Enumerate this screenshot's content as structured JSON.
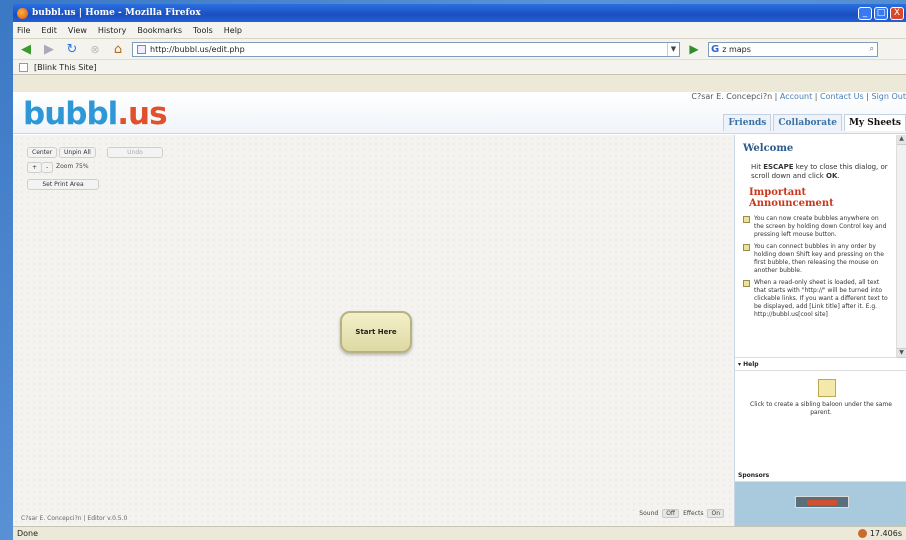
{
  "window": {
    "title": "bubbl.us | Home - Mozilla Firefox",
    "controls": [
      "_",
      "□",
      "X"
    ]
  },
  "menu": [
    "File",
    "Edit",
    "View",
    "History",
    "Bookmarks",
    "Tools",
    "Help"
  ],
  "nav": {
    "url": "http://bubbl.us/edit.php",
    "search_value": "z maps"
  },
  "bookmarks": {
    "item": "[Blink This Site]"
  },
  "site": {
    "logo_a": "bubbl",
    "logo_b": ".us",
    "user": "C?sar E. Concepci?n",
    "links": [
      "Account",
      "Contact Us",
      "Sign Out"
    ],
    "tabs": [
      "Friends",
      "Collaborate",
      "My Sheets"
    ]
  },
  "toolbar": {
    "center": "Center",
    "unpin": "Unpin All",
    "undo": "Undo",
    "zoom_plus": "+",
    "zoom_minus": "-",
    "zoom": "Zoom 75%",
    "print": "Set Print Area"
  },
  "bubble": {
    "text": "Start Here"
  },
  "footer": {
    "credit": "C?sar E. Concepci?n | Editor v.0.5.0",
    "sound_label": "Sound",
    "sound_value": "Off",
    "effects_label": "Effects",
    "effects_value": "On"
  },
  "welcome": {
    "title": "Welcome",
    "intro_pre": "Hit ",
    "intro_key": "ESCAPE",
    "intro_mid": " key to close this dialog, or scroll down and click ",
    "intro_ok": "OK",
    "intro_end": ".",
    "announce_title": "Important Announcement",
    "items": [
      "You can now create bubbles anywhere on the screen by holding down Control key and pressing left mouse button.",
      "You can connect bubbles in any order by holding down Shift key and pressing on the first bubble, then releasing the mouse on another bubble.",
      "When a read-only sheet is loaded, all text that starts with \"http://\" will be turned into clickable links. If you want a different text to be displayed, add [Link title] after it. E.g. http://bubbl.us[cool site]"
    ]
  },
  "help": {
    "title": "▾ Help",
    "text": "Click to create a sibling baloon under the same parent."
  },
  "sponsors": {
    "title": "Sponsors"
  },
  "status": {
    "left": "Done",
    "right": "17.406s"
  }
}
